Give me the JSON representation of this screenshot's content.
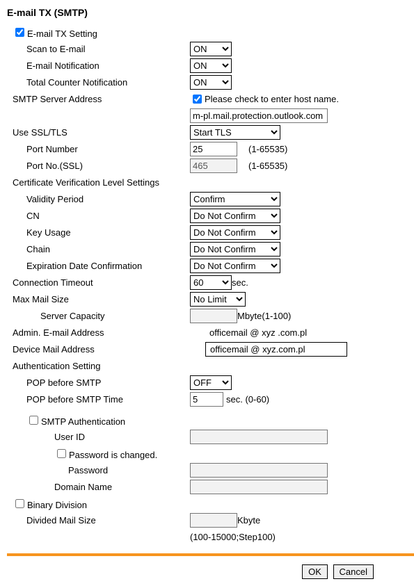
{
  "title": "E-mail TX (SMTP)",
  "labels": {
    "email_tx_setting": "E-mail TX Setting",
    "scan_to_email": "Scan to E-mail",
    "email_notification": "E-mail Notification",
    "total_counter_notification": "Total Counter Notification",
    "smtp_server_address": "SMTP Server Address",
    "check_hostname": "Please check to enter host name.",
    "use_ssl_tls": "Use SSL/TLS",
    "port_number": "Port Number",
    "port_no_ssl": "Port No.(SSL)",
    "cert_verif": "Certificate Verification Level Settings",
    "validity_period": "Validity Period",
    "cn": "CN",
    "key_usage": "Key Usage",
    "chain": "Chain",
    "expiration_date": "Expiration Date Confirmation",
    "connection_timeout": "Connection Timeout",
    "max_mail_size": "Max Mail Size",
    "server_capacity": "Server Capacity",
    "admin_email": "Admin. E-mail Address",
    "device_mail": "Device Mail Address",
    "auth_setting": "Authentication Setting",
    "pop_before_smtp": "POP before SMTP",
    "pop_before_smtp_time": "POP before SMTP Time",
    "smtp_auth": "SMTP Authentication",
    "user_id": "User ID",
    "password_changed": "Password is changed.",
    "password": "Password",
    "domain_name": "Domain Name",
    "binary_division": "Binary Division",
    "divided_mail_size": "Divided Mail Size"
  },
  "values": {
    "scan_to_email": "ON",
    "email_notification": "ON",
    "total_counter_notification": "ON",
    "server_address": "m-pl.mail.protection.outlook.com",
    "ssl_tls": "Start TLS",
    "port_number": "25",
    "port_ssl": "465",
    "validity_period": "Confirm",
    "cn": "Do Not Confirm",
    "key_usage": "Do Not Confirm",
    "chain": "Do Not Confirm",
    "expiration_date": "Do Not Confirm",
    "connection_timeout": "60",
    "max_mail_size": "No Limit",
    "server_capacity": "",
    "admin_email": "officemail @  xyz .com.pl",
    "device_email": "officemail @   xyz.com.pl",
    "pop_before_smtp": "OFF",
    "pop_time": "5",
    "user_id": "",
    "password": "",
    "domain_name": "",
    "divided_mail_size": ""
  },
  "ranges": {
    "port": "(1-65535)",
    "server_cap": "Mbyte(1-100)",
    "timeout_unit": "sec.",
    "pop_time": "sec. (0-60)",
    "divided": "Kbyte",
    "divided2": "(100-15000;Step100)"
  },
  "buttons": {
    "ok": "OK",
    "cancel": "Cancel"
  }
}
